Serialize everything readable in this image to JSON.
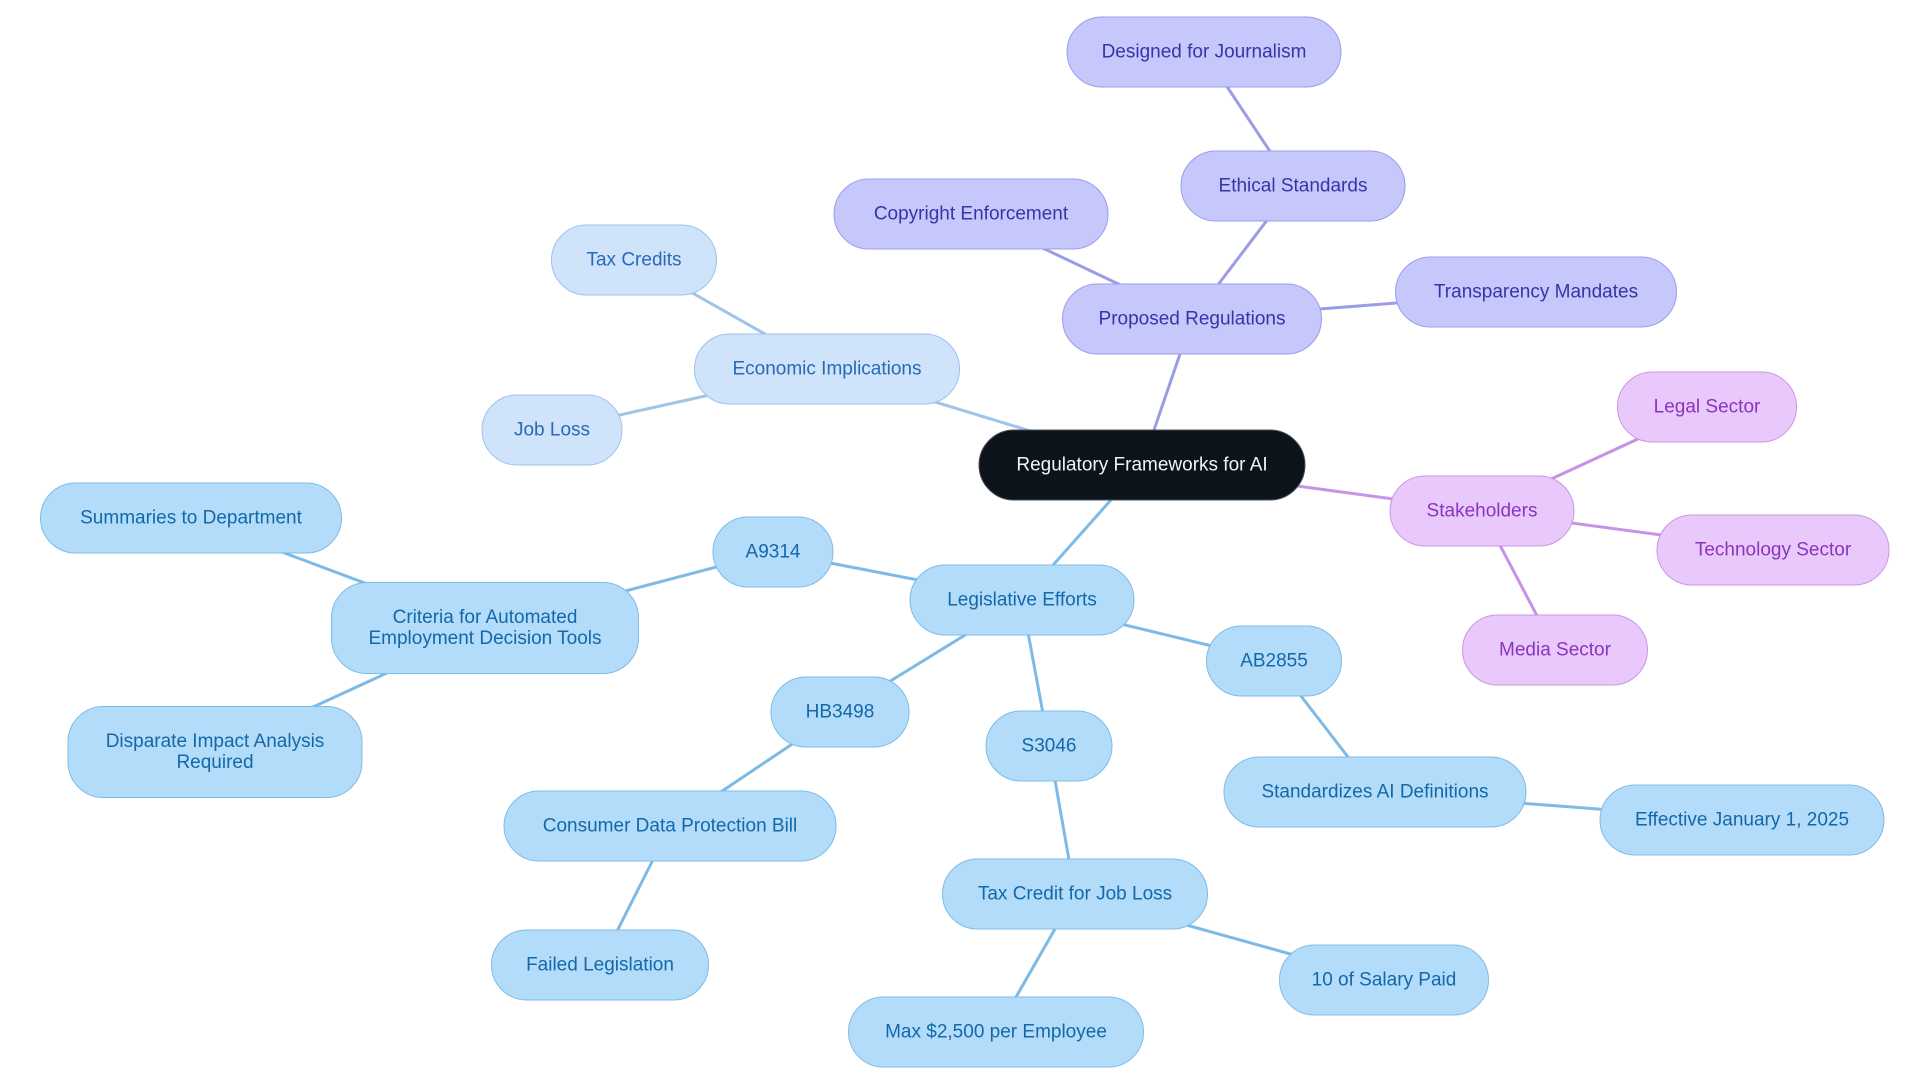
{
  "diagram": {
    "type": "mind-map",
    "title": "Regulatory Frameworks for AI",
    "colors": {
      "root": "#0c131b",
      "economic_branch": "#cfe3fb",
      "economic_edge": "#9fc4ea",
      "proposed_branch": "#c6c8fb",
      "proposed_edge": "#9a9de6",
      "stakeholders_branch": "#e9c9fb",
      "stakeholders_edge": "#c693e6",
      "legislative_branch": "#b3dcfa",
      "legislative_edge": "#7dbbe6"
    },
    "nodes": [
      {
        "id": "root",
        "label": "Regulatory Frameworks for AI",
        "branch": "root"
      },
      {
        "id": "econ",
        "label": "Economic Implications",
        "branch": "econ",
        "parent": "root"
      },
      {
        "id": "taxcredits",
        "label": "Tax Credits",
        "branch": "econ",
        "parent": "econ"
      },
      {
        "id": "jobloss",
        "label": "Job Loss",
        "branch": "econ",
        "parent": "econ"
      },
      {
        "id": "proposed",
        "label": "Proposed Regulations",
        "branch": "prop",
        "parent": "root"
      },
      {
        "id": "copyright",
        "label": "Copyright Enforcement",
        "branch": "prop",
        "parent": "proposed"
      },
      {
        "id": "ethical",
        "label": "Ethical Standards",
        "branch": "prop",
        "parent": "proposed"
      },
      {
        "id": "journalism",
        "label": "Designed for Journalism",
        "branch": "prop",
        "parent": "ethical"
      },
      {
        "id": "transparency",
        "label": "Transparency Mandates",
        "branch": "prop",
        "parent": "proposed"
      },
      {
        "id": "stakeholders",
        "label": "Stakeholders",
        "branch": "stake",
        "parent": "root"
      },
      {
        "id": "legal",
        "label": "Legal Sector",
        "branch": "stake",
        "parent": "stakeholders"
      },
      {
        "id": "tech",
        "label": "Technology Sector",
        "branch": "stake",
        "parent": "stakeholders"
      },
      {
        "id": "media",
        "label": "Media Sector",
        "branch": "stake",
        "parent": "stakeholders"
      },
      {
        "id": "legis",
        "label": "Legislative Efforts",
        "branch": "legis",
        "parent": "root"
      },
      {
        "id": "a9314",
        "label": "A9314",
        "branch": "legis",
        "parent": "legis"
      },
      {
        "id": "criteria",
        "label": "Criteria for Automated\nEmployment Decision Tools",
        "branch": "legis",
        "parent": "a9314"
      },
      {
        "id": "summaries",
        "label": "Summaries to Department",
        "branch": "legis",
        "parent": "criteria"
      },
      {
        "id": "disparate",
        "label": "Disparate Impact Analysis\nRequired",
        "branch": "legis",
        "parent": "criteria"
      },
      {
        "id": "hb3498",
        "label": "HB3498",
        "branch": "legis",
        "parent": "legis"
      },
      {
        "id": "consumer",
        "label": "Consumer Data Protection Bill",
        "branch": "legis",
        "parent": "hb3498"
      },
      {
        "id": "failed",
        "label": "Failed Legislation",
        "branch": "legis",
        "parent": "consumer"
      },
      {
        "id": "s3046",
        "label": "S3046",
        "branch": "legis",
        "parent": "legis"
      },
      {
        "id": "taxjob",
        "label": "Tax Credit for Job Loss",
        "branch": "legis",
        "parent": "s3046"
      },
      {
        "id": "max2500",
        "label": "Max $2,500 per Employee",
        "branch": "legis",
        "parent": "taxjob"
      },
      {
        "id": "salary",
        "label": "10 of Salary Paid",
        "branch": "legis",
        "parent": "taxjob"
      },
      {
        "id": "ab2855",
        "label": "AB2855",
        "branch": "legis",
        "parent": "legis"
      },
      {
        "id": "standardizes",
        "label": "Standardizes AI Definitions",
        "branch": "legis",
        "parent": "ab2855"
      },
      {
        "id": "effective",
        "label": "Effective January 1, 2025",
        "branch": "legis",
        "parent": "standardizes"
      }
    ]
  }
}
